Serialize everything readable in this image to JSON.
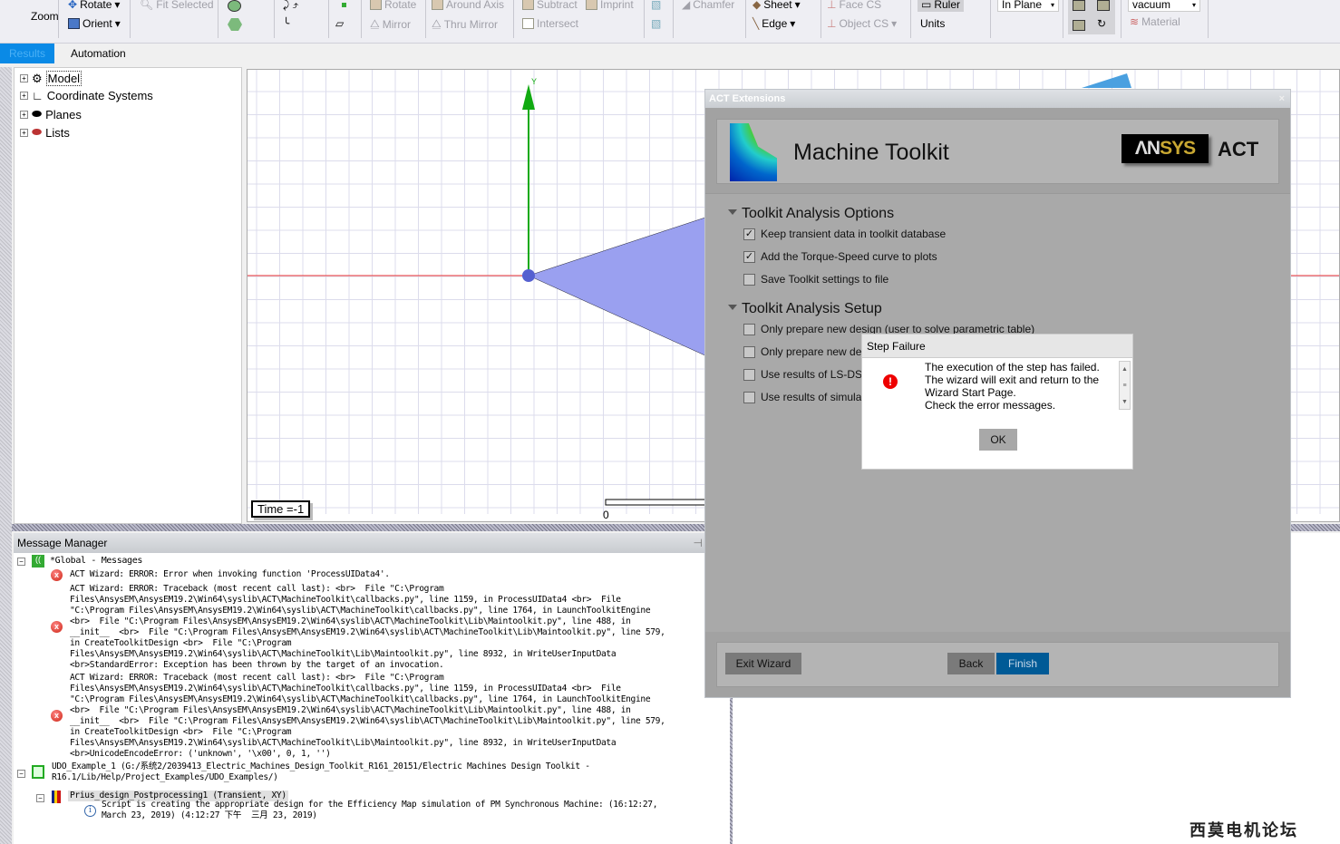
{
  "toolbar": {
    "zoom": "Zoom",
    "rotate": "Rotate",
    "orient": "Orient",
    "fit_selected": "Fit Selected",
    "rotate2": "Rotate",
    "around_axis": "Around Axis",
    "mirror": "Mirror",
    "thru_mirror": "Thru Mirror",
    "subtract": "Subtract",
    "imprint": "Imprint",
    "intersect": "Intersect",
    "chamfer": "Chamfer",
    "sheet": "Sheet",
    "edge": "Edge",
    "face_cs": "Face CS",
    "object_cs": "Object CS",
    "ruler": "Ruler",
    "units": "Units",
    "in_plane": "In Plane",
    "material_value": "vacuum",
    "material": "Material"
  },
  "tabs": [
    {
      "label": "Results",
      "active": true
    },
    {
      "label": "Automation"
    }
  ],
  "tree": [
    "Model",
    "Coordinate Systems",
    "Planes",
    "Lists"
  ],
  "viewport": {
    "axis_y": "Y",
    "time": "Time =-1",
    "scale_zero": "0"
  },
  "message_manager": {
    "title": "Message Manager",
    "global": "*Global - Messages",
    "error1": [
      "ACT Wizard: ERROR: Error when invoking function 'ProcessUIData4'."
    ],
    "error2": [
      "ACT Wizard: ERROR: Traceback (most recent call last): <br>  File \"C:\\Program",
      "Files\\AnsysEM\\AnsysEM19.2\\Win64\\syslib\\ACT\\MachineToolkit\\callbacks.py\", line 1159, in ProcessUIData4 <br>  File",
      "\"C:\\Program Files\\AnsysEM\\AnsysEM19.2\\Win64\\syslib\\ACT\\MachineToolkit\\callbacks.py\", line 1764, in LaunchToolkitEngine",
      "<br>  File \"C:\\Program Files\\AnsysEM\\AnsysEM19.2\\Win64\\syslib\\ACT\\MachineToolkit\\Lib\\Maintoolkit.py\", line 488, in",
      "__init__  <br>  File \"C:\\Program Files\\AnsysEM\\AnsysEM19.2\\Win64\\syslib\\ACT\\MachineToolkit\\Lib\\Maintoolkit.py\", line 579,",
      "in CreateToolkitDesign <br>  File \"C:\\Program",
      "Files\\AnsysEM\\AnsysEM19.2\\Win64\\syslib\\ACT\\MachineToolkit\\Lib\\Maintoolkit.py\", line 8932, in WriteUserInputData",
      "<br>StandardError: Exception has been thrown by the target of an invocation."
    ],
    "error3": [
      "ACT Wizard: ERROR: Traceback (most recent call last): <br>  File \"C:\\Program",
      "Files\\AnsysEM\\AnsysEM19.2\\Win64\\syslib\\ACT\\MachineToolkit\\callbacks.py\", line 1159, in ProcessUIData4 <br>  File",
      "\"C:\\Program Files\\AnsysEM\\AnsysEM19.2\\Win64\\syslib\\ACT\\MachineToolkit\\callbacks.py\", line 1764, in LaunchToolkitEngine",
      "<br>  File \"C:\\Program Files\\AnsysEM\\AnsysEM19.2\\Win64\\syslib\\ACT\\MachineToolkit\\Lib\\Maintoolkit.py\", line 488, in",
      "__init__  <br>  File \"C:\\Program Files\\AnsysEM\\AnsysEM19.2\\Win64\\syslib\\ACT\\MachineToolkit\\Lib\\Maintoolkit.py\", line 579,",
      "in CreateToolkitDesign <br>  File \"C:\\Program",
      "Files\\AnsysEM\\AnsysEM19.2\\Win64\\syslib\\ACT\\MachineToolkit\\Lib\\Maintoolkit.py\", line 8932, in WriteUserInputData",
      "<br>UnicodeEncodeError: ('unknown', '\\x00', 0, 1, '')"
    ],
    "project": [
      "UDO_Example_1 (G:/系统2/2039413_Electric_Machines_Design_Toolkit_R161_20151/Electric Machines Design Toolkit -",
      "R16.1/Lib/Help/Project_Examples/UDO_Examples/)"
    ],
    "design": "Prius_design_Postprocessing1 (Transient, XY)",
    "info": [
      "Script is creating the appropriate design for the Efficiency Map simulation of PM Synchronous Machine: (16:12:27,",
      "March 23, 2019) (4:12:27 下午  三月 23, 2019)"
    ]
  },
  "act": {
    "window_title": "ACT Extensions",
    "header": "Machine Toolkit",
    "logo_ansys": "ANSYS",
    "logo_act": "ACT",
    "section1": "Toolkit Analysis Options",
    "options1": [
      {
        "label": "Keep transient data in toolkit database",
        "checked": true
      },
      {
        "label": "Add the Torque-Speed curve to plots",
        "checked": true
      },
      {
        "label": "Save Toolkit settings to file",
        "checked": false
      }
    ],
    "section2": "Toolkit Analysis Setup",
    "options2": [
      {
        "label": "Only prepare new design (user to solve parametric table)",
        "checked": false
      },
      {
        "label": "Only prepare new de",
        "checked": false
      },
      {
        "label": "Use results of LS-DS",
        "checked": false
      },
      {
        "label": "Use results of simula",
        "checked": false
      }
    ],
    "exit": "Exit Wizard",
    "back": "Back",
    "finish": "Finish",
    "accent": "#005a96"
  },
  "popup": {
    "title": "Step Failure",
    "lines": [
      "The execution of the step has failed.",
      "The wizard will exit and return to the",
      "Wizard Start Page.",
      "Check the error messages."
    ],
    "ok": "OK"
  },
  "watermark": "西莫电机论坛"
}
